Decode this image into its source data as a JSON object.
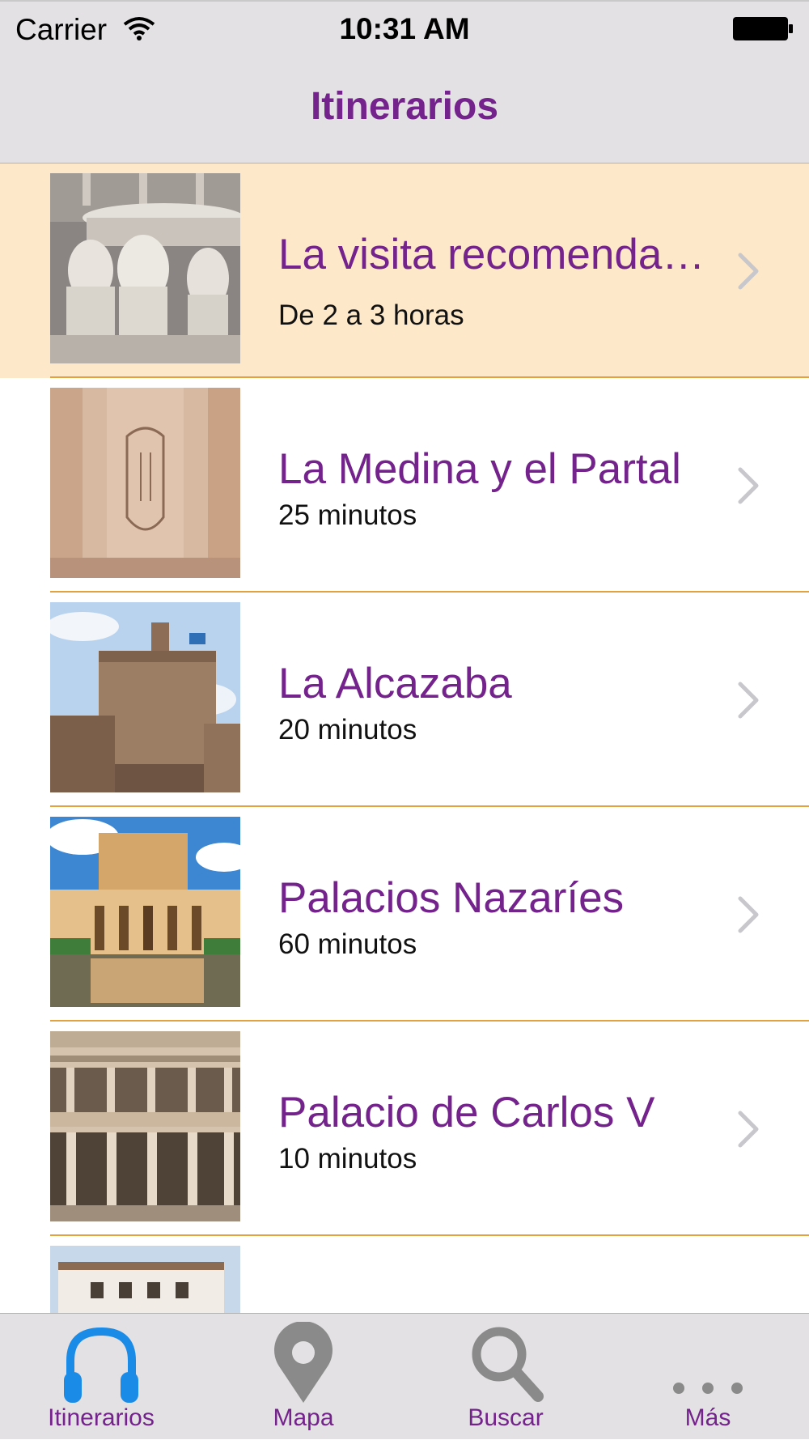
{
  "status_bar": {
    "carrier": "Carrier",
    "time": "10:31 AM"
  },
  "nav": {
    "title": "Itinerarios"
  },
  "itineraries": [
    {
      "title": "La visita recomenda…",
      "duration": "De 2 a 3 horas",
      "selected": true
    },
    {
      "title": "La Medina y el Partal",
      "duration": "25 minutos",
      "selected": false
    },
    {
      "title": "La Alcazaba",
      "duration": "20 minutos",
      "selected": false
    },
    {
      "title": "Palacios Nazaríes",
      "duration": "60 minutos",
      "selected": false
    },
    {
      "title": "Palacio de Carlos V",
      "duration": "10 minutos",
      "selected": false
    }
  ],
  "tabs": [
    {
      "label": "Itinerarios",
      "icon": "headphones-icon",
      "active": true
    },
    {
      "label": "Mapa",
      "icon": "map-pin-icon",
      "active": false
    },
    {
      "label": "Buscar",
      "icon": "search-icon",
      "active": false
    },
    {
      "label": "Más",
      "icon": "more-icon",
      "active": false
    }
  ],
  "colors": {
    "accent": "#74228c",
    "active_tab_icon": "#1b8be8",
    "inactive_tab_icon": "#8a8a8a",
    "selected_row": "#fde8c9",
    "separator": "#e2a23f",
    "bar_background": "#e3e1e3"
  }
}
